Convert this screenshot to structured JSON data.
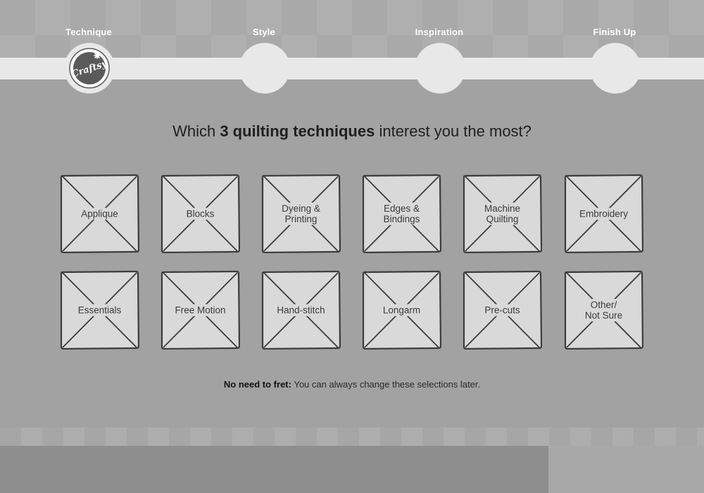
{
  "progress": {
    "steps": [
      {
        "label": "Technique"
      },
      {
        "label": "Style"
      },
      {
        "label": "Inspiration"
      },
      {
        "label": "Finish Up"
      }
    ],
    "current_step": "Technique"
  },
  "brand": {
    "logo_text": "Craftsy"
  },
  "question": {
    "prefix": "Which ",
    "emphasis": "3 quilting techniques",
    "suffix": " interest you the most?"
  },
  "options": [
    {
      "label": "Applique"
    },
    {
      "label": "Blocks"
    },
    {
      "label": "Dyeing &\nPrinting"
    },
    {
      "label": "Edges &\nBindings"
    },
    {
      "label": "Machine\nQuilting"
    },
    {
      "label": "Embroidery"
    },
    {
      "label": "Essentials"
    },
    {
      "label": "Free Motion"
    },
    {
      "label": "Hand-stitch"
    },
    {
      "label": "Longarm"
    },
    {
      "label": "Pre-cuts"
    },
    {
      "label": "Other/\nNot Sure"
    }
  ],
  "note": {
    "strong": "No need to fret:",
    "text": " You can always change these selections later."
  },
  "colors": {
    "background": "#a2a2a2",
    "track": "#e8e8e8",
    "tile_fill": "#d9d9d9",
    "tile_stroke": "#3c3c3c",
    "footer_dark": "#8e8e8e",
    "footer_light": "#a8a8a8",
    "logo_fill": "#5a5a5a"
  }
}
